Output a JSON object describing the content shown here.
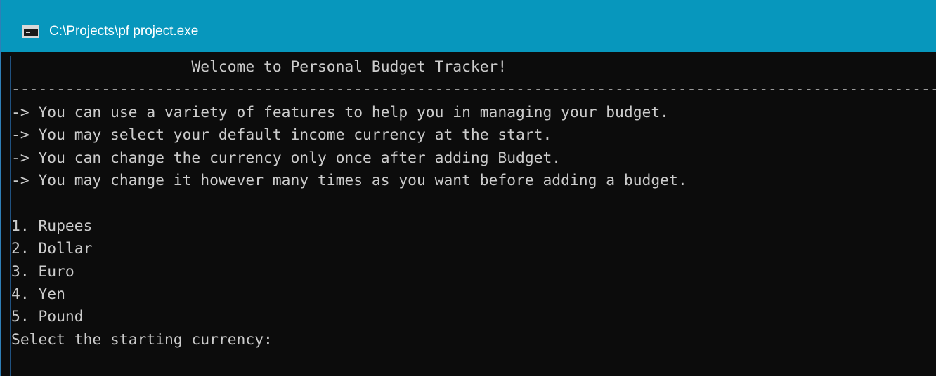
{
  "window": {
    "title": "C:\\Projects\\pf project.exe",
    "icon": "console-app-icon"
  },
  "console": {
    "heading": "                    Welcome to Personal Budget Tracker!",
    "separator": "------------------------------------------------------------------------------------------------------------------------",
    "info_lines": [
      "-> You can use a variety of features to help you in managing your budget.",
      "-> You may select your default income currency at the start.",
      "-> You can change the currency only once after adding Budget.",
      "-> You may change it however many times as you want before adding a budget."
    ],
    "currency_options": [
      "1. Rupees",
      "2. Dollar",
      "3. Euro",
      "4. Yen",
      "5. Pound"
    ],
    "prompt": "Select the starting currency:"
  },
  "colors": {
    "titlebar": "#0797bd",
    "console_bg": "#0c0c0c",
    "console_text": "#cccccc"
  }
}
